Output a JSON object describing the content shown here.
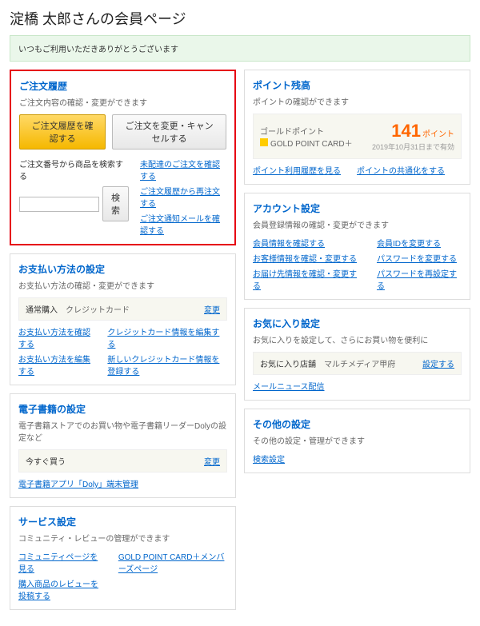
{
  "page_title": "淀橋 太郎さんの会員ページ",
  "notice": "いつもご利用いただきありがとうございます",
  "order": {
    "title": "ご注文履歴",
    "desc": "ご注文内容の確認・変更ができます",
    "btn_history": "ご注文履歴を確認する",
    "btn_change": "ご注文を変更・キャンセルする",
    "search_label": "ご注文番号から商品を検索する",
    "btn_search": "検索",
    "links": [
      "未配達のご注文を確認する",
      "ご注文履歴から再注文する",
      "ご注文通知メールを確認する"
    ]
  },
  "points": {
    "title": "ポイント残高",
    "desc": "ポイントの確認ができます",
    "gp_label": "ゴールドポイント",
    "gp_card": "GOLD POINT CARD＋",
    "value": "141",
    "unit": "ポイント",
    "expire": "2019年10月31日まで有効",
    "link1": "ポイント利用履歴を見る",
    "link2": "ポイントの共通化をする"
  },
  "payment": {
    "title": "お支払い方法の設定",
    "desc": "お支払い方法の確認・変更ができます",
    "box_label": "通常購入",
    "box_val": "クレジットカード",
    "box_act": "変更",
    "l1": "お支払い方法を確認する",
    "l2": "お支払い方法を編集する",
    "l3": "クレジットカード情報を編集する",
    "l4": "新しいクレジットカード情報を登録する"
  },
  "account": {
    "title": "アカウント設定",
    "desc": "会員登録情報の確認・変更ができます",
    "l1": "会員情報を確認する",
    "l2": "お客様情報を確認・変更する",
    "l3": "お届け先情報を確認・変更する",
    "l4": "会員IDを変更する",
    "l5": "パスワードを変更する",
    "l6": "パスワードを再設定する"
  },
  "ebook": {
    "title": "電子書籍の設定",
    "desc": "電子書籍ストアでのお買い物や電子書籍リーダーDolyの設定など",
    "box_label": "今すぐ買う",
    "box_act": "変更",
    "l1": "電子書籍アプリ「Doly」端末管理"
  },
  "favorite": {
    "title": "お気に入り設定",
    "desc": "お気に入りを設定して、さらにお買い物を便利に",
    "box_label": "お気に入り店舗",
    "box_val": "マルチメディア甲府",
    "box_act": "設定する",
    "l1": "メールニュース配信"
  },
  "service": {
    "title": "サービス設定",
    "desc": "コミュニティ・レビューの管理ができます",
    "l1": "コミュニティページを見る",
    "l2": "購入商品のレビューを投稿する",
    "l3": "GOLD POINT CARD＋メンバーズページ"
  },
  "other": {
    "title": "その他の設定",
    "desc": "その他の設定・管理ができます",
    "l1": "検索設定"
  }
}
